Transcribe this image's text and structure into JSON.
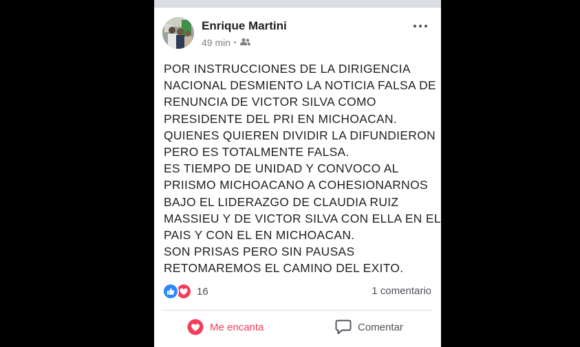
{
  "post": {
    "author": "Enrique Martini",
    "time": "49 min",
    "separator": "•",
    "audience_icon": "friends-icon",
    "more_icon": "more-options-icon",
    "text_lines": [
      "POR INSTRUCCIONES DE LA DIRIGENCIA",
      "NACIONAL DESMIENTO LA NOTICIA FALSA DE",
      "RENUNCIA DE VICTOR SILVA COMO",
      "PRESIDENTE DEL PRI EN MICHOACAN.",
      "QUIENES QUIEREN DIVIDIR LA DIFUNDIERON",
      "PERO ES TOTALMENTE FALSA.",
      "ES TIEMPO DE UNIDAD Y CONVOCO AL",
      "PRIISMO MICHOACANO A COHESIONARNOS",
      "BAJO EL LIDERAZGO DE CLAUDIA RUIZ",
      "MASSIEU Y DE VICTOR SILVA CON ELLA EN EL",
      "PAIS Y CON EL EN MICHOACAN.",
      "SON PRISAS PERO SIN PAUSAS",
      "RETOMAREMOS EL CAMINO DEL EXITO."
    ]
  },
  "reactions": {
    "count": "16",
    "icons": [
      "like-icon",
      "love-icon"
    ],
    "comments_label": "1 comentario"
  },
  "actions": {
    "love_label": "Me encanta",
    "comment_label": "Comentar"
  },
  "colors": {
    "like_blue": "#2d88ff",
    "love_red": "#f33e58",
    "text": "#1c1e21",
    "meta_gray": "#7f7f7f"
  }
}
